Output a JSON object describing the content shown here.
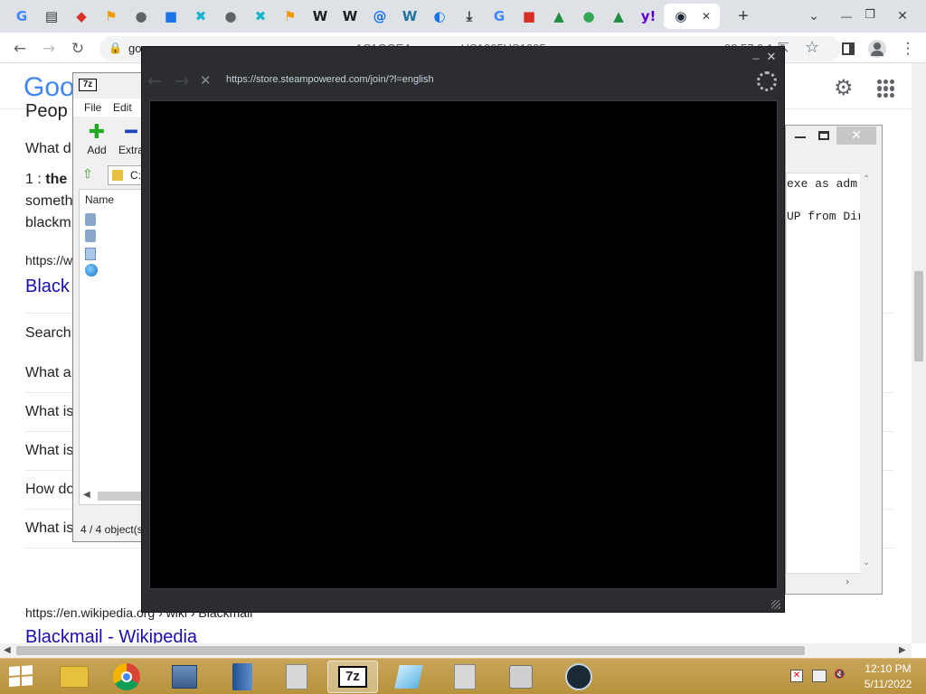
{
  "browser": {
    "tabs": [
      {
        "icon": "google-icon",
        "glyph": "G",
        "color": "#4285f4"
      },
      {
        "icon": "bookmark-app-icon",
        "glyph": "▤",
        "color": "#333333"
      },
      {
        "icon": "red-tab-icon",
        "glyph": "◆",
        "color": "#d93025"
      },
      {
        "icon": "orange-person-icon",
        "glyph": "⚑",
        "color": "#f29900"
      },
      {
        "icon": "globe-icon",
        "glyph": "●",
        "color": "#5f6368"
      },
      {
        "icon": "blue-shape-icon",
        "glyph": "■",
        "color": "#1a73e8"
      },
      {
        "icon": "teal-x-icon",
        "glyph": "✖",
        "color": "#12b5cb"
      },
      {
        "icon": "gear-globe-icon",
        "glyph": "●",
        "color": "#5f6368"
      },
      {
        "icon": "teal-x-icon",
        "glyph": "✖",
        "color": "#12b5cb"
      },
      {
        "icon": "orange-person-icon",
        "glyph": "⚑",
        "color": "#f29900"
      },
      {
        "icon": "wikipedia-icon",
        "glyph": "W",
        "color": "#202124"
      },
      {
        "icon": "wikipedia-icon",
        "glyph": "W",
        "color": "#202124"
      },
      {
        "icon": "at-sign-icon",
        "glyph": "@",
        "color": "#1a73e8"
      },
      {
        "icon": "wordpress-icon",
        "glyph": "W",
        "color": "#21759b"
      },
      {
        "icon": "blue-circle-icon",
        "glyph": "◐",
        "color": "#1a73e8"
      },
      {
        "icon": "download-icon",
        "glyph": "⤓",
        "color": "#333333"
      },
      {
        "icon": "google-icon",
        "glyph": "G",
        "color": "#4285f4"
      },
      {
        "icon": "red-lock-icon",
        "glyph": "■",
        "color": "#d93025"
      },
      {
        "icon": "green-leaf-icon",
        "glyph": "▲",
        "color": "#1e8e3e"
      },
      {
        "icon": "earth-icon",
        "glyph": "●",
        "color": "#34a853"
      },
      {
        "icon": "green-leaf-icon",
        "glyph": "▲",
        "color": "#1e8e3e"
      },
      {
        "icon": "yahoo-icon",
        "glyph": "y!",
        "color": "#6001d2"
      },
      {
        "icon": "steam-icon",
        "glyph": "◉",
        "color": "#1b2838"
      }
    ],
    "active_tab_close": "✕",
    "new_tab": "+",
    "window_controls": {
      "dropdown": "⌄",
      "minimize": "—",
      "restore": "❐",
      "close": "✕"
    },
    "address_fragments": [
      "go",
      "1C1GGEA",
      "US1005US1005",
      "08:57:0:1"
    ],
    "bookmark_star": "☆"
  },
  "google_page": {
    "logo_text": "Goo",
    "people_also_ask_partial": "Peop",
    "what_d": "What d",
    "definition_prefix": "1 : ",
    "definition_bold": "the",
    "someth": "someth",
    "blackm": "blackm",
    "https_w": "https://w",
    "black_link": "Black",
    "search_label": "Search",
    "questions": [
      "What a",
      "What is",
      "What is",
      "How do",
      "What is"
    ],
    "wiki_url": "https://en.wikipedia.org › wiki › Blackmail",
    "wiki_title": "Blackmail - Wikipedia"
  },
  "sevenzip": {
    "logo": "7z",
    "menu": [
      "File",
      "Edit"
    ],
    "toolbar": [
      {
        "label": "Add",
        "glyph": "✚",
        "color": "#22aa22"
      },
      {
        "label": "Extra",
        "glyph": "━",
        "color": "#1a3fbf"
      }
    ],
    "path": "C:\\",
    "column_name": "Name",
    "status": "4 / 4 object(s"
  },
  "console": {
    "lines": [
      "exe as adm:",
      "UP from Dir"
    ]
  },
  "steam": {
    "url": "https://store.steampowered.com/join/?l=english",
    "back": "←",
    "forward": "→",
    "stop": "✕",
    "minimize": "_",
    "close": "✕"
  },
  "taskbar": {
    "time": "12:10 PM",
    "date": "5/11/2022",
    "seven_zip_label": "7z"
  }
}
